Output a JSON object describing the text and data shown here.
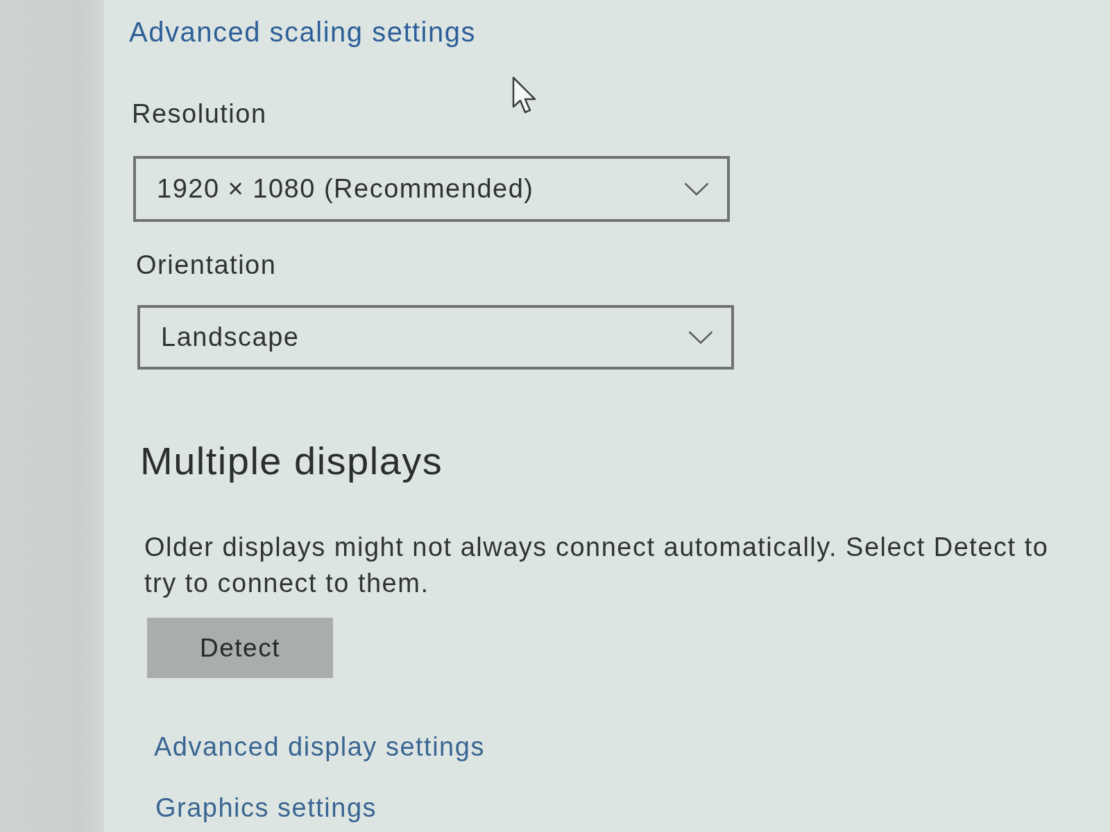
{
  "scaling_link": {
    "label": "Advanced scaling settings"
  },
  "dropdowns": [
    {
      "label": "Resolution",
      "value": "1920 × 1080 (Recommended)"
    },
    {
      "label": "Orientation",
      "value": "Landscape"
    }
  ],
  "multiple_displays": {
    "heading": "Multiple displays",
    "description": "Older displays might not always connect automatically. Select Detect to try to connect to them.",
    "button": "Detect"
  },
  "links": [
    "Advanced display settings",
    "Graphics settings"
  ]
}
